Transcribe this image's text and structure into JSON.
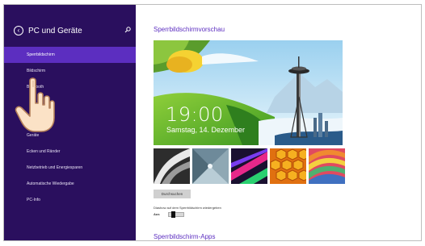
{
  "sidebar": {
    "back_glyph": "‹",
    "title": "PC und Geräte",
    "search_icon": "search-icon",
    "items": [
      {
        "label": "Sperrbildschirm",
        "selected": true
      },
      {
        "label": "Bildschirm"
      },
      {
        "label": "Bluetooth"
      },
      {
        "label": ""
      },
      {
        "label": ""
      },
      {
        "label": "Geräte"
      },
      {
        "label": "Ecken und Ränder"
      },
      {
        "label": "Netzbetrieb und Energiesparen"
      },
      {
        "label": "Automatische Wiedergabe"
      },
      {
        "label": "PC-Info"
      }
    ]
  },
  "main": {
    "preview_heading": "Sperrbildschirmvorschau",
    "preview_time": "19:00",
    "preview_date": "Samstag, 14. Dezember",
    "browse_label": "Durchsuchen",
    "slideshow_label": "Diashow auf dem Sperrbildschirm wiedergeben",
    "toggle_state": "Aus",
    "toggle_value": false,
    "apps_heading": "Sperrbildschirm-Apps"
  },
  "colors": {
    "sidebar_bg": "#2a0f5e",
    "selected_bg": "#5c2ec0",
    "accent": "#5c2ec0"
  }
}
